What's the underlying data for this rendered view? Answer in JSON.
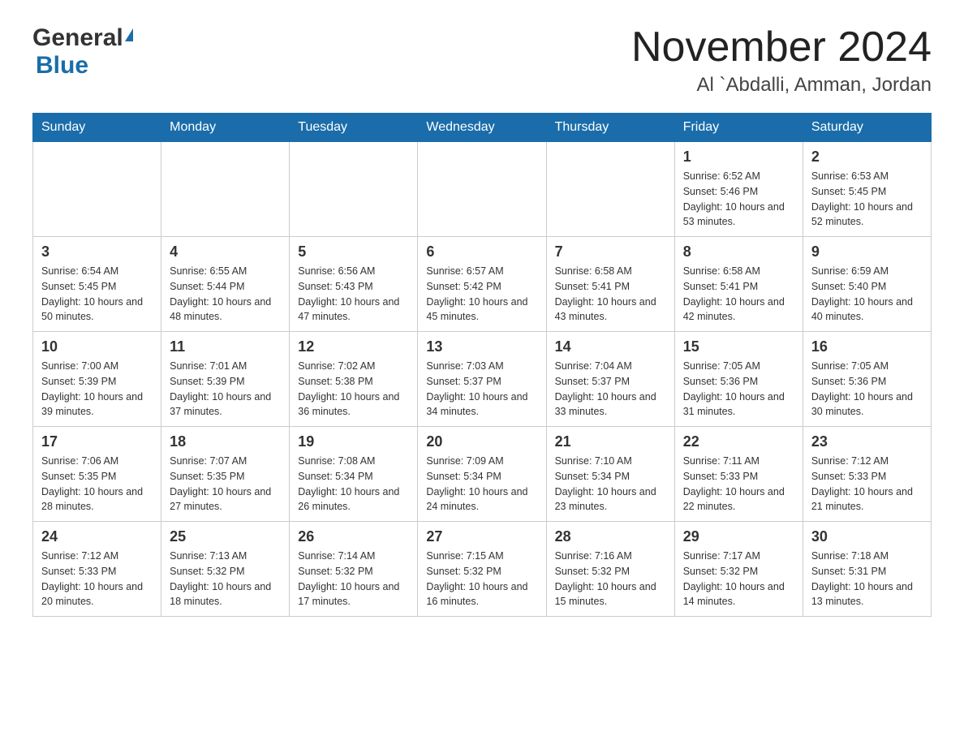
{
  "logo": {
    "general": "General",
    "blue": "Blue"
  },
  "title": "November 2024",
  "subtitle": "Al `Abdalli, Amman, Jordan",
  "days_of_week": [
    "Sunday",
    "Monday",
    "Tuesday",
    "Wednesday",
    "Thursday",
    "Friday",
    "Saturday"
  ],
  "weeks": [
    [
      {
        "day": "",
        "info": ""
      },
      {
        "day": "",
        "info": ""
      },
      {
        "day": "",
        "info": ""
      },
      {
        "day": "",
        "info": ""
      },
      {
        "day": "",
        "info": ""
      },
      {
        "day": "1",
        "info": "Sunrise: 6:52 AM\nSunset: 5:46 PM\nDaylight: 10 hours and 53 minutes."
      },
      {
        "day": "2",
        "info": "Sunrise: 6:53 AM\nSunset: 5:45 PM\nDaylight: 10 hours and 52 minutes."
      }
    ],
    [
      {
        "day": "3",
        "info": "Sunrise: 6:54 AM\nSunset: 5:45 PM\nDaylight: 10 hours and 50 minutes."
      },
      {
        "day": "4",
        "info": "Sunrise: 6:55 AM\nSunset: 5:44 PM\nDaylight: 10 hours and 48 minutes."
      },
      {
        "day": "5",
        "info": "Sunrise: 6:56 AM\nSunset: 5:43 PM\nDaylight: 10 hours and 47 minutes."
      },
      {
        "day": "6",
        "info": "Sunrise: 6:57 AM\nSunset: 5:42 PM\nDaylight: 10 hours and 45 minutes."
      },
      {
        "day": "7",
        "info": "Sunrise: 6:58 AM\nSunset: 5:41 PM\nDaylight: 10 hours and 43 minutes."
      },
      {
        "day": "8",
        "info": "Sunrise: 6:58 AM\nSunset: 5:41 PM\nDaylight: 10 hours and 42 minutes."
      },
      {
        "day": "9",
        "info": "Sunrise: 6:59 AM\nSunset: 5:40 PM\nDaylight: 10 hours and 40 minutes."
      }
    ],
    [
      {
        "day": "10",
        "info": "Sunrise: 7:00 AM\nSunset: 5:39 PM\nDaylight: 10 hours and 39 minutes."
      },
      {
        "day": "11",
        "info": "Sunrise: 7:01 AM\nSunset: 5:39 PM\nDaylight: 10 hours and 37 minutes."
      },
      {
        "day": "12",
        "info": "Sunrise: 7:02 AM\nSunset: 5:38 PM\nDaylight: 10 hours and 36 minutes."
      },
      {
        "day": "13",
        "info": "Sunrise: 7:03 AM\nSunset: 5:37 PM\nDaylight: 10 hours and 34 minutes."
      },
      {
        "day": "14",
        "info": "Sunrise: 7:04 AM\nSunset: 5:37 PM\nDaylight: 10 hours and 33 minutes."
      },
      {
        "day": "15",
        "info": "Sunrise: 7:05 AM\nSunset: 5:36 PM\nDaylight: 10 hours and 31 minutes."
      },
      {
        "day": "16",
        "info": "Sunrise: 7:05 AM\nSunset: 5:36 PM\nDaylight: 10 hours and 30 minutes."
      }
    ],
    [
      {
        "day": "17",
        "info": "Sunrise: 7:06 AM\nSunset: 5:35 PM\nDaylight: 10 hours and 28 minutes."
      },
      {
        "day": "18",
        "info": "Sunrise: 7:07 AM\nSunset: 5:35 PM\nDaylight: 10 hours and 27 minutes."
      },
      {
        "day": "19",
        "info": "Sunrise: 7:08 AM\nSunset: 5:34 PM\nDaylight: 10 hours and 26 minutes."
      },
      {
        "day": "20",
        "info": "Sunrise: 7:09 AM\nSunset: 5:34 PM\nDaylight: 10 hours and 24 minutes."
      },
      {
        "day": "21",
        "info": "Sunrise: 7:10 AM\nSunset: 5:34 PM\nDaylight: 10 hours and 23 minutes."
      },
      {
        "day": "22",
        "info": "Sunrise: 7:11 AM\nSunset: 5:33 PM\nDaylight: 10 hours and 22 minutes."
      },
      {
        "day": "23",
        "info": "Sunrise: 7:12 AM\nSunset: 5:33 PM\nDaylight: 10 hours and 21 minutes."
      }
    ],
    [
      {
        "day": "24",
        "info": "Sunrise: 7:12 AM\nSunset: 5:33 PM\nDaylight: 10 hours and 20 minutes."
      },
      {
        "day": "25",
        "info": "Sunrise: 7:13 AM\nSunset: 5:32 PM\nDaylight: 10 hours and 18 minutes."
      },
      {
        "day": "26",
        "info": "Sunrise: 7:14 AM\nSunset: 5:32 PM\nDaylight: 10 hours and 17 minutes."
      },
      {
        "day": "27",
        "info": "Sunrise: 7:15 AM\nSunset: 5:32 PM\nDaylight: 10 hours and 16 minutes."
      },
      {
        "day": "28",
        "info": "Sunrise: 7:16 AM\nSunset: 5:32 PM\nDaylight: 10 hours and 15 minutes."
      },
      {
        "day": "29",
        "info": "Sunrise: 7:17 AM\nSunset: 5:32 PM\nDaylight: 10 hours and 14 minutes."
      },
      {
        "day": "30",
        "info": "Sunrise: 7:18 AM\nSunset: 5:31 PM\nDaylight: 10 hours and 13 minutes."
      }
    ]
  ]
}
